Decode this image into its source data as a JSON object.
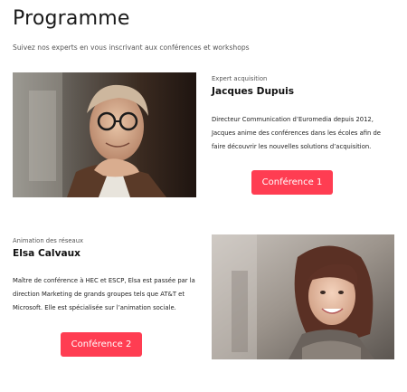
{
  "page": {
    "title": "Programme",
    "subtitle": "Suivez nos experts en vous inscrivant aux conférences et workshops"
  },
  "speakers": [
    {
      "role": "Expert acquisition",
      "name": "Jacques Dupuis",
      "description": "Directeur Communication d’Euromedia depuis 2012, Jacques anime des conférences dans les écoles afin de faire découvrir les nouvelles solutions d’acquisition.",
      "button_label": "Conférence 1"
    },
    {
      "role": "Animation des réseaux",
      "name": "Elsa Calvaux",
      "description": "Maître de conférence à HEC et ESCP, Elsa est passée par la direction Marketing de grands groupes tels que AT&T et Microsoft. Elle est spécialisée sur l’animation sociale.",
      "button_label": "Conférence 2"
    }
  ],
  "colors": {
    "accent": "#ff3d52",
    "text": "#1f1f1f",
    "muted": "#555555"
  }
}
